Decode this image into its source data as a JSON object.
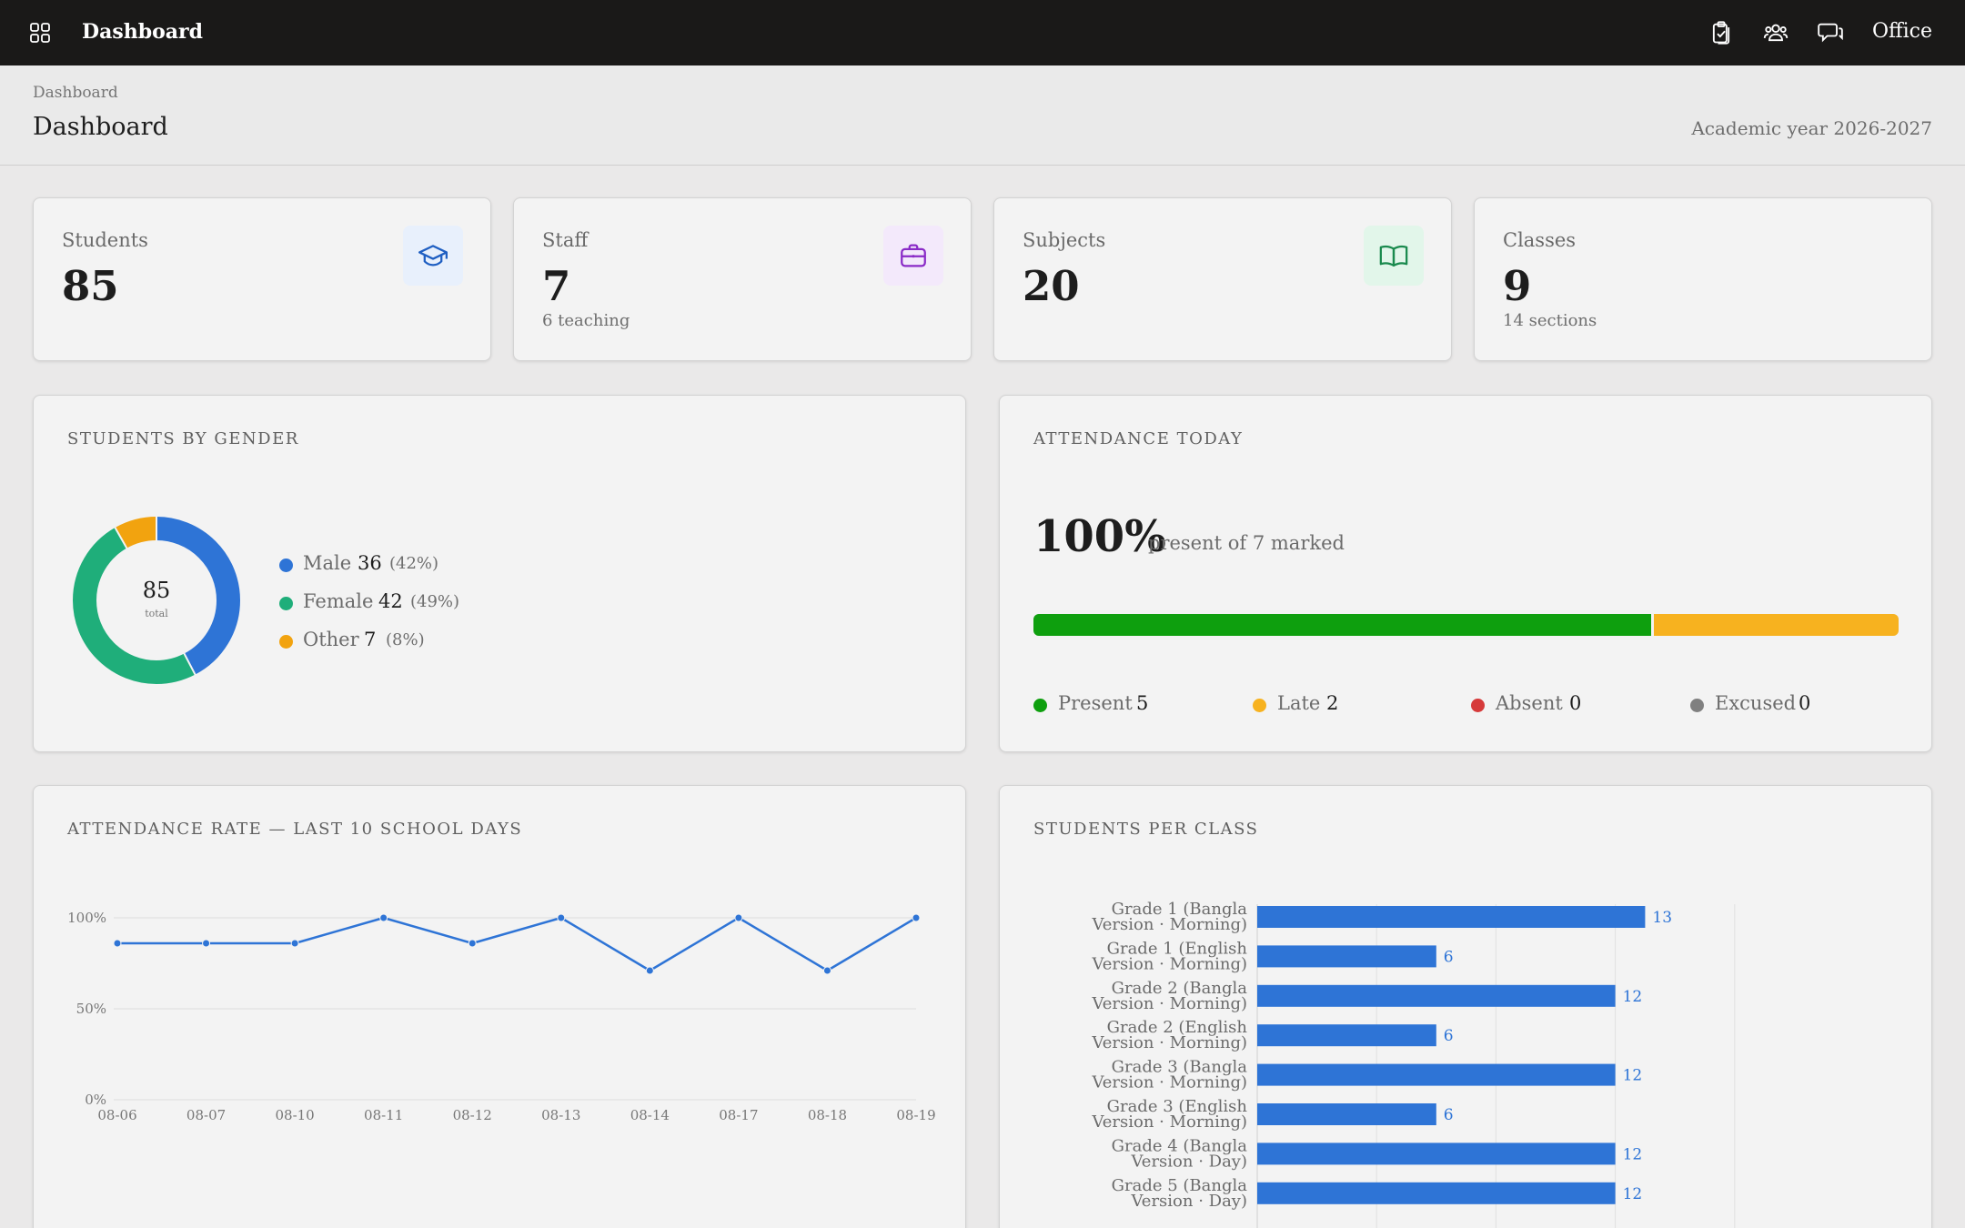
{
  "topbar": {
    "title": "Dashboard",
    "user": "Office",
    "icons": [
      "apps-grid-icon",
      "clipboard-check-icon",
      "users-icon",
      "chat-bubbles-icon"
    ]
  },
  "header": {
    "breadcrumb": "Dashboard",
    "title": "Dashboard",
    "academic_year": "Academic year 2026-2027"
  },
  "stats": [
    {
      "label": "Students",
      "value": "85",
      "sub": "",
      "icon": "graduation-cap-icon",
      "icon_bg": "#e8f0fc",
      "icon_color": "#1f5fc2"
    },
    {
      "label": "Staff",
      "value": "7",
      "sub": "6 teaching",
      "icon": "briefcase-icon",
      "icon_bg": "#f3e9fb",
      "icon_color": "#8a2bc7"
    },
    {
      "label": "Subjects",
      "value": "20",
      "sub": "",
      "icon": "book-open-icon",
      "icon_bg": "#e2f6ea",
      "icon_color": "#1a8a4e"
    },
    {
      "label": "Classes",
      "value": "9",
      "sub": "14 sections",
      "icon": "",
      "icon_bg": "",
      "icon_color": ""
    }
  ],
  "gender": {
    "title": "STUDENTS BY GENDER",
    "total": "85",
    "total_label": "total",
    "items": [
      {
        "name": "Male",
        "count": 36,
        "count_label": "36",
        "pct": "(42%)",
        "color": "#2e74d6"
      },
      {
        "name": "Female",
        "count": 42,
        "count_label": "42",
        "pct": "(49%)",
        "color": "#1fae7a"
      },
      {
        "name": "Other",
        "count": 7,
        "count_label": "7",
        "pct": "(8%)",
        "color": "#f2a30f"
      }
    ]
  },
  "attendance_today": {
    "title": "ATTENDANCE TODAY",
    "percent": "100%",
    "subtitle": "present of 7 marked",
    "items": [
      {
        "name": "Present",
        "count": 5,
        "count_label": "5",
        "color": "#0e9f0e"
      },
      {
        "name": "Late",
        "count": 2,
        "count_label": "2",
        "color": "#f7b21f"
      },
      {
        "name": "Absent",
        "count": 0,
        "count_label": "0",
        "color": "#d63a3a"
      },
      {
        "name": "Excused",
        "count": 0,
        "count_label": "0",
        "color": "#808080"
      }
    ]
  },
  "attendance_rate": {
    "title": "ATTENDANCE RATE — LAST 10 SCHOOL DAYS"
  },
  "students_per_class": {
    "title": "STUDENTS PER CLASS"
  },
  "chart_data": [
    {
      "type": "pie",
      "title": "STUDENTS BY GENDER",
      "categories": [
        "Male",
        "Female",
        "Other"
      ],
      "values": [
        36,
        42,
        7
      ]
    },
    {
      "type": "line",
      "title": "ATTENDANCE RATE — LAST 10 SCHOOL DAYS",
      "categories": [
        "08-06",
        "08-07",
        "08-10",
        "08-11",
        "08-12",
        "08-13",
        "08-14",
        "08-17",
        "08-18",
        "08-19"
      ],
      "values": [
        86,
        86,
        86,
        100,
        86,
        100,
        71,
        100,
        71,
        100
      ],
      "yticks": [
        "0%",
        "50%",
        "100%"
      ],
      "ylim": [
        0,
        100
      ],
      "grid": true,
      "color": "#2e74d6"
    },
    {
      "type": "bar",
      "orientation": "horizontal",
      "title": "STUDENTS PER CLASS",
      "categories": [
        [
          "Grade 1 (Bangla",
          "Version · Morning)"
        ],
        [
          "Grade 1 (English",
          "Version · Morning)"
        ],
        [
          "Grade 2 (Bangla",
          "Version · Morning)"
        ],
        [
          "Grade 2 (English",
          "Version · Morning)"
        ],
        [
          "Grade 3 (Bangla",
          "Version · Morning)"
        ],
        [
          "Grade 3 (English",
          "Version · Morning)"
        ],
        [
          "Grade 4 (Bangla",
          "Version · Day)"
        ],
        [
          "Grade 5 (Bangla",
          "Version · Day)"
        ]
      ],
      "values": [
        13,
        6,
        12,
        6,
        12,
        6,
        12,
        12
      ],
      "xlim": [
        0,
        16
      ],
      "grid": true,
      "color": "#2e74d6"
    }
  ]
}
